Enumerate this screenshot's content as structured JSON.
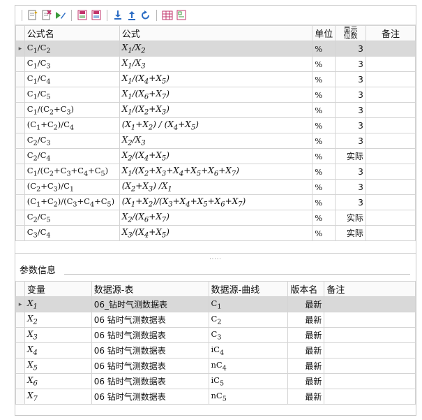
{
  "formula_table": {
    "headers": {
      "name": "公式名",
      "formula": "公式",
      "unit": "单位",
      "digits": "显示\n位数",
      "note": "备注"
    },
    "rows": [
      {
        "name_html": "C<sub>1</sub>/C<sub>2</sub>",
        "formula_html": "X<sub>1</sub>/X<sub>2</sub>",
        "unit": "%",
        "digits": "3",
        "note": "",
        "selected": true
      },
      {
        "name_html": "C<sub>1</sub>/C<sub>3</sub>",
        "formula_html": "X<sub>1</sub>/X<sub>3</sub>",
        "unit": "%",
        "digits": "3",
        "note": ""
      },
      {
        "name_html": "C<sub>1</sub>/C<sub>4</sub>",
        "formula_html": "X<sub>1</sub>/(X<sub>4</sub>+X<sub>5</sub>)",
        "unit": "%",
        "digits": "3",
        "note": ""
      },
      {
        "name_html": "C<sub>1</sub>/C<sub>5</sub>",
        "formula_html": "X<sub>1</sub>/(X<sub>6</sub>+X<sub>7</sub>)",
        "unit": "%",
        "digits": "3",
        "note": ""
      },
      {
        "name_html": "C<sub>1</sub>/(C<sub>2</sub>+C<sub>3</sub>)",
        "formula_html": "X<sub>1</sub>/(X<sub>2</sub>+X<sub>3</sub>)",
        "unit": "%",
        "digits": "3",
        "note": ""
      },
      {
        "name_html": "(C<sub>1</sub>+C<sub>2</sub>)/C<sub>4</sub>",
        "formula_html": "(X<sub>1</sub>+X<sub>2</sub>) / (X<sub>4</sub>+X<sub>5</sub>)",
        "unit": "%",
        "digits": "3",
        "note": ""
      },
      {
        "name_html": "C<sub>2</sub>/C<sub>3</sub>",
        "formula_html": "X<sub>2</sub>/X<sub>3</sub>",
        "unit": "%",
        "digits": "3",
        "note": ""
      },
      {
        "name_html": "C<sub>2</sub>/C<sub>4</sub>",
        "formula_html": "X<sub>2</sub>/(X<sub>4</sub>+X<sub>5</sub>)",
        "unit": "%",
        "digits": "实际",
        "note": ""
      },
      {
        "name_html": "C<sub>1</sub>/(C<sub>2</sub>+C<sub>3</sub>+C<sub>4</sub>+C<sub>5</sub>)",
        "formula_html": "X<sub>1</sub>/(X<sub>2</sub>+X<sub>3</sub>+X<sub>4</sub>+X<sub>5</sub>+X<sub>6</sub>+X<sub>7</sub>)",
        "unit": "%",
        "digits": "3",
        "note": ""
      },
      {
        "name_html": "(C<sub>2</sub>+C<sub>3</sub>)/C<sub>1</sub>",
        "formula_html": "(X<sub>2</sub>+X<sub>3</sub>) /X<sub>1</sub>",
        "unit": "%",
        "digits": "3",
        "note": ""
      },
      {
        "name_html": "(C<sub>1</sub>+C<sub>2</sub>)/(C<sub>3</sub>+C<sub>4</sub>+C<sub>5</sub>)",
        "formula_html": "(X<sub>1</sub>+X<sub>2</sub>)/(X<sub>3</sub>+X<sub>4</sub>+X<sub>5</sub>+X<sub>6</sub>+X<sub>7</sub>)",
        "unit": "%",
        "digits": "3",
        "note": ""
      },
      {
        "name_html": "C<sub>2</sub>/C<sub>5</sub>",
        "formula_html": "X<sub>2</sub>/(X<sub>6</sub>+X<sub>7</sub>)",
        "unit": "%",
        "digits": "实际",
        "note": ""
      },
      {
        "name_html": "C<sub>3</sub>/C<sub>4</sub>",
        "formula_html": "X<sub>3</sub>/(X<sub>4</sub>+X<sub>5</sub>)",
        "unit": "%",
        "digits": "实际",
        "note": ""
      }
    ]
  },
  "splitter_dots": "·····",
  "param_section": {
    "label": "参数信息"
  },
  "param_table": {
    "headers": {
      "var": "变量",
      "source_table": "数据源-表",
      "source_curve": "数据源-曲线",
      "version": "版本名",
      "note": "备注"
    },
    "rows": [
      {
        "var_html": "X<sub>1</sub>",
        "source_table": "06_钻时气测数据表",
        "curve_html": "C<sub>1</sub>",
        "version": "最新",
        "note": "",
        "selected": true
      },
      {
        "var_html": "X<sub>2</sub>",
        "source_table": "06 钻时气测数据表",
        "curve_html": "C<sub>2</sub>",
        "version": "最新",
        "note": ""
      },
      {
        "var_html": "X<sub>3</sub>",
        "source_table": "06 钻时气测数据表",
        "curve_html": "C<sub>3</sub>",
        "version": "最新",
        "note": ""
      },
      {
        "var_html": "X<sub>4</sub>",
        "source_table": "06 钻时气测数据表",
        "curve_html": "iC<sub>4</sub>",
        "version": "最新",
        "note": ""
      },
      {
        "var_html": "X<sub>5</sub>",
        "source_table": "06 钻时气测数据表",
        "curve_html": "nC<sub>4</sub>",
        "version": "最新",
        "note": ""
      },
      {
        "var_html": "X<sub>6</sub>",
        "source_table": "06 钻时气测数据表",
        "curve_html": "iC<sub>5</sub>",
        "version": "最新",
        "note": ""
      },
      {
        "var_html": "X<sub>7</sub>",
        "source_table": "06 钻时气测数据表",
        "curve_html": "nC<sub>5</sub>",
        "version": "最新",
        "note": ""
      }
    ]
  },
  "colors": {
    "selected_row": "#d9d9d9",
    "toolbar_icon_green": "#3a9a3a",
    "toolbar_icon_blue": "#2b6cc4",
    "toolbar_icon_pink": "#c2336b"
  }
}
